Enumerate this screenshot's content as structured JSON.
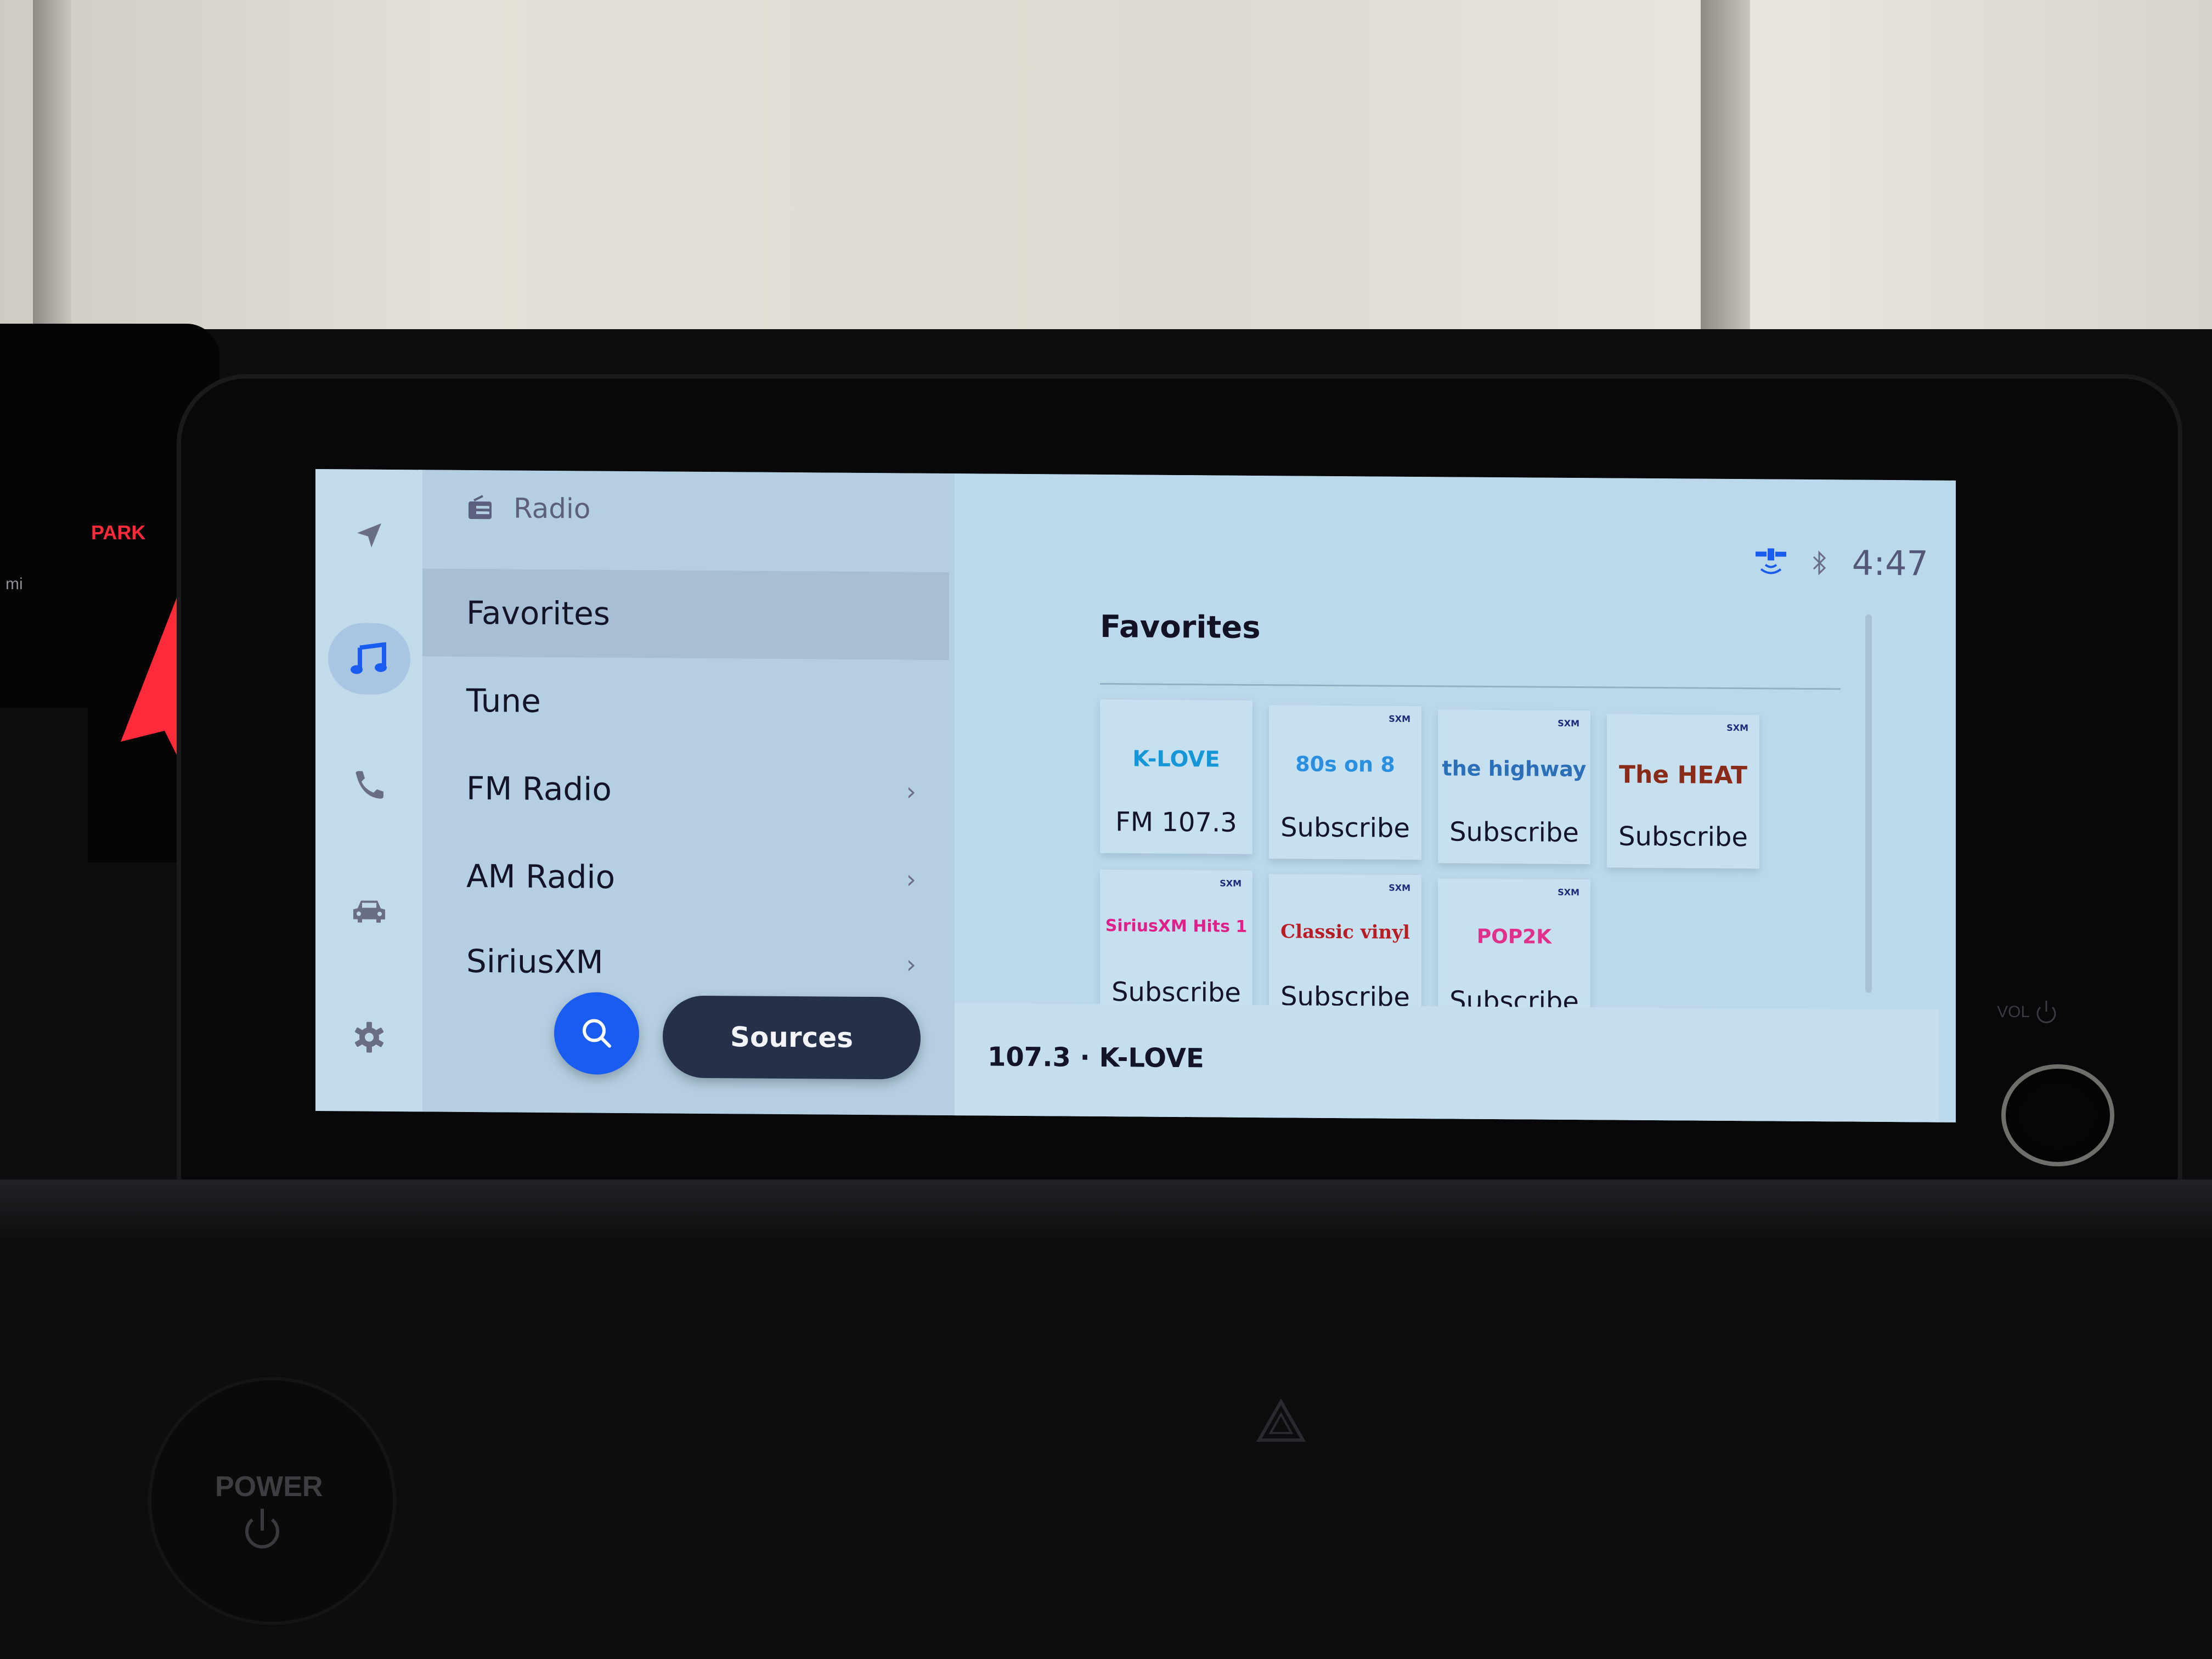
{
  "surroundings": {
    "cluster_indicator": "PARK",
    "cluster_unit": "mi",
    "power_button_label": "POWER",
    "volume_label": "VOL"
  },
  "rail": {
    "items": [
      {
        "name": "navigation",
        "icon": "navigation-arrow-icon",
        "active": false
      },
      {
        "name": "media",
        "icon": "music-note-icon",
        "active": true
      },
      {
        "name": "phone",
        "icon": "phone-icon",
        "active": false
      },
      {
        "name": "vehicle",
        "icon": "car-icon",
        "active": false
      },
      {
        "name": "settings",
        "icon": "gear-icon",
        "active": false
      }
    ]
  },
  "menu": {
    "header_icon": "radio-icon",
    "header_title": "Radio",
    "items": [
      {
        "label": "Favorites",
        "selected": true,
        "has_chevron": false
      },
      {
        "label": "Tune",
        "selected": false,
        "has_chevron": false
      },
      {
        "label": "FM Radio",
        "selected": false,
        "has_chevron": true
      },
      {
        "label": "AM Radio",
        "selected": false,
        "has_chevron": true
      },
      {
        "label": "SiriusXM",
        "selected": false,
        "has_chevron": true
      }
    ],
    "search_icon": "search-icon",
    "sources_label": "Sources"
  },
  "status_bar": {
    "icons": [
      "satellite-signal-icon",
      "bluetooth-icon"
    ],
    "time": "4:47"
  },
  "content": {
    "title": "Favorites",
    "tiles": [
      {
        "logo": "K-LOVE",
        "caption": "FM 107.3",
        "sxm_badge": false,
        "logo_color": "#1596d6"
      },
      {
        "logo": "80s on 8",
        "caption": "Subscribe",
        "sxm_badge": true,
        "badge_text": "SXM",
        "logo_color": "#2b8fe0"
      },
      {
        "logo": "the highway",
        "caption": "Subscribe",
        "sxm_badge": true,
        "badge_text": "SXM",
        "logo_color": "#2a6fb8"
      },
      {
        "logo": "The HEAT",
        "caption": "Subscribe",
        "sxm_badge": true,
        "badge_text": "SXM",
        "logo_color": "#8a2a18"
      },
      {
        "logo": "SiriusXM Hits 1",
        "caption": "Subscribe",
        "sxm_badge": true,
        "badge_text": "SXM",
        "logo_color": "#e0208a"
      },
      {
        "logo": "Classic vinyl",
        "caption": "Subscribe",
        "sxm_badge": true,
        "badge_text": "SXM",
        "logo_color": "#b81c24"
      },
      {
        "logo": "POP2K",
        "caption": "Subscribe",
        "sxm_badge": true,
        "badge_text": "SXM",
        "logo_color": "#e0308c"
      }
    ],
    "now_playing": "107.3 · K-LOVE"
  },
  "colors": {
    "accent": "#1a5cf0",
    "sources_button": "#25304a",
    "screen_bg": "#bcd9ec",
    "selected_row": "#a7bed5"
  }
}
